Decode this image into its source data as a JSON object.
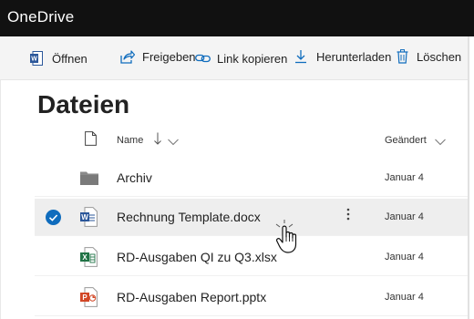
{
  "app": {
    "title": "OneDrive"
  },
  "commands": {
    "open": "Öffnen",
    "share": "Freigeben",
    "copy_link": "Link kopieren",
    "download": "Herunterladen",
    "delete": "Löschen"
  },
  "page": {
    "title": "Dateien"
  },
  "columns": {
    "name": "Name",
    "modified": "Geändert"
  },
  "files": [
    {
      "name": "Archiv",
      "modified": "Januar 4",
      "type": "folder",
      "selected": false
    },
    {
      "name": "Rechnung Template.docx",
      "modified": "Januar 4",
      "type": "word",
      "selected": true
    },
    {
      "name": "RD-Ausgaben QI zu Q3.xlsx",
      "modified": "Januar 4",
      "type": "excel",
      "selected": false
    },
    {
      "name": "RD-Ausgaben Report.pptx",
      "modified": "Januar 4",
      "type": "powerpoint",
      "selected": false
    }
  ],
  "colors": {
    "topbar": "#111111",
    "commandbar": "#f4f4f4",
    "selected_row": "#eeeeee",
    "accent": "#0f6cbd",
    "word": "#2b579a",
    "excel": "#217346",
    "powerpoint": "#d24726",
    "folder": "#8a8a8a"
  },
  "icons": {
    "open": "word-file-icon",
    "share": "share-icon",
    "copy_link": "link-icon",
    "download": "download-icon",
    "delete": "trash-icon",
    "header_file": "file-icon",
    "sort": "sort-down-arrow-icon",
    "column_menu": "chevron-down-icon",
    "more": "more-vertical-icon",
    "cursor": "hand-pointer-icon"
  }
}
